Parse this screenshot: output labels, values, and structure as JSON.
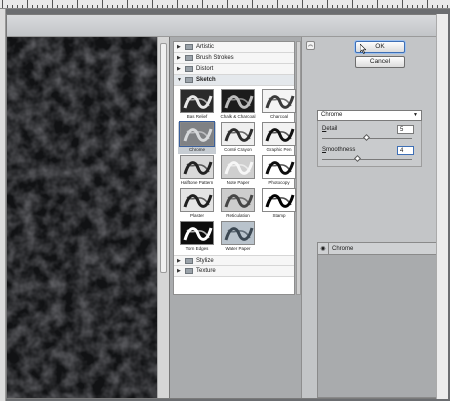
{
  "dialog": {
    "ok_label": "OK",
    "cancel_label": "Cancel"
  },
  "gallery": {
    "categories_top": [
      {
        "label": "Artistic",
        "expanded": false
      },
      {
        "label": "Brush Strokes",
        "expanded": false
      },
      {
        "label": "Distort",
        "expanded": false
      },
      {
        "label": "Sketch",
        "expanded": true
      }
    ],
    "sketch_filters": [
      {
        "label": "Bas Relief"
      },
      {
        "label": "Chalk & Charcoal"
      },
      {
        "label": "Charcoal"
      },
      {
        "label": "Chrome",
        "selected": true
      },
      {
        "label": "Conté Crayon"
      },
      {
        "label": "Graphic Pen"
      },
      {
        "label": "Halftone Pattern"
      },
      {
        "label": "Note Paper"
      },
      {
        "label": "Photocopy"
      },
      {
        "label": "Plaster"
      },
      {
        "label": "Reticulation"
      },
      {
        "label": "Stamp"
      },
      {
        "label": "Torn Edges"
      },
      {
        "label": "Water Paper"
      }
    ],
    "categories_bottom": [
      {
        "label": "Stylize",
        "expanded": false
      },
      {
        "label": "Texture",
        "expanded": false
      }
    ]
  },
  "settings": {
    "filter_select": "Chrome",
    "detail": {
      "label_prefix": "",
      "label_underlined": "D",
      "label_rest": "etail",
      "value": "5",
      "max": 10
    },
    "smoothness": {
      "label_prefix": "",
      "label_underlined": "S",
      "label_rest": "moothness",
      "value": "4",
      "max": 10
    }
  },
  "layers": {
    "items": [
      {
        "name": "Chrome"
      }
    ]
  },
  "icons": {
    "collapse": "double-chevron-up-icon",
    "folder": "folder-icon",
    "eye": "eye-icon",
    "cursor": "mouse-pointer-icon"
  }
}
